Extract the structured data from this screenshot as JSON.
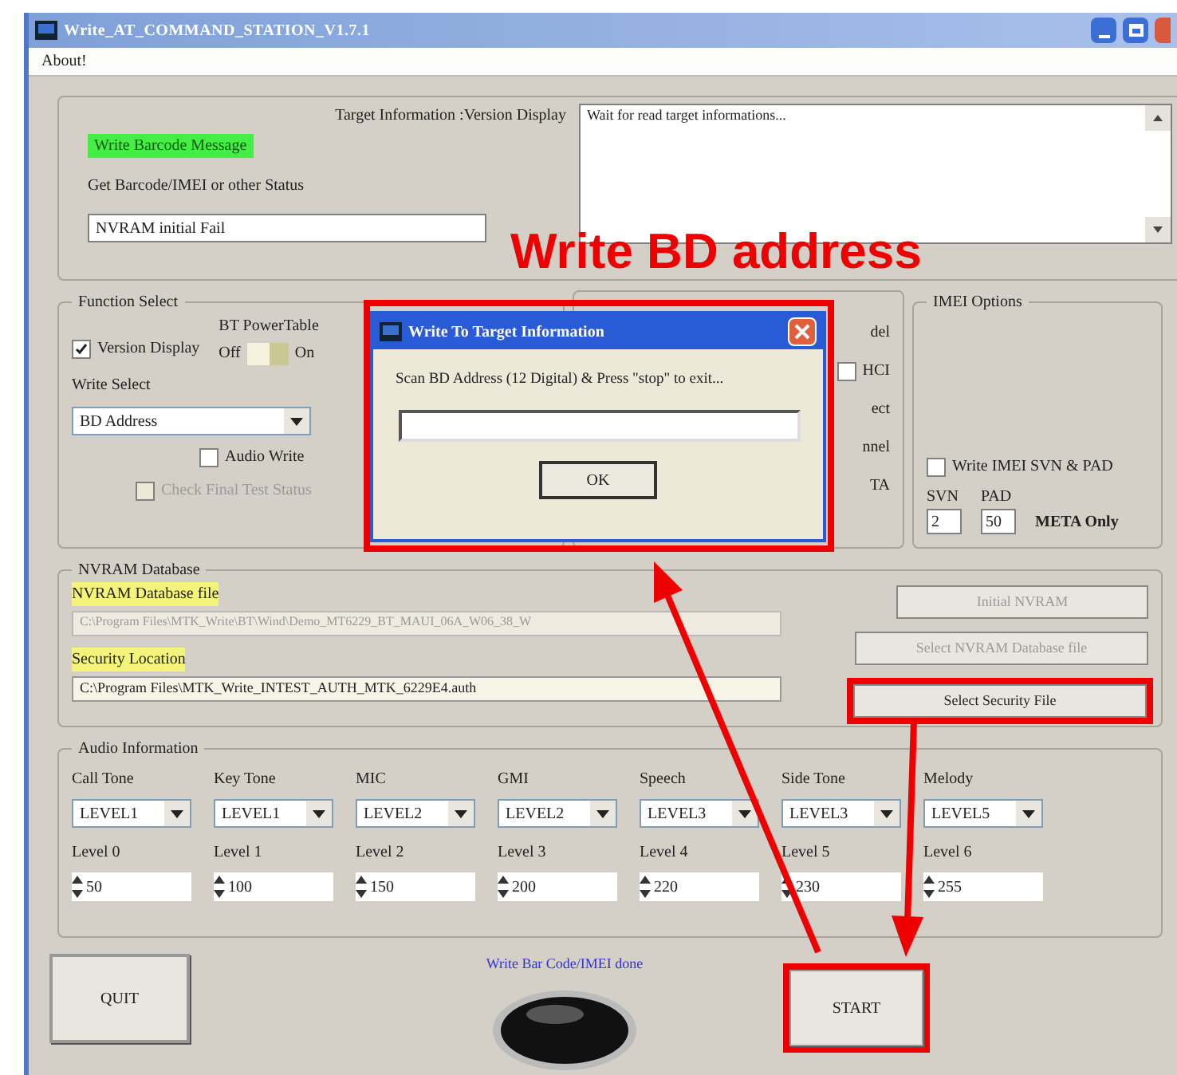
{
  "window": {
    "title": "Write_AT_COMMAND_STATION_V1.7.1"
  },
  "menu": [
    "About!"
  ],
  "target_info": {
    "title": "Target Information :Version Display",
    "barcode_message": "Write Barcode Message",
    "status_label": "Get Barcode/IMEI or other Status",
    "status_value": "NVRAM initial Fail",
    "log": "Wait for read target informations..."
  },
  "function_select": {
    "title": "Function Select",
    "version_display": {
      "label": "Version Display",
      "checked": true
    },
    "bt_power_table": {
      "label": "BT PowerTable",
      "off": "Off",
      "on_label": "On",
      "on": true
    },
    "write_select_label": "Write Select",
    "write_select_value": "BD Address",
    "audio_write": {
      "label": "Audio Write",
      "checked": false
    },
    "check_final": {
      "label": "Check Final Test Status",
      "checked": false,
      "disabled": true
    }
  },
  "middle_group": {
    "fragments": [
      {
        "kind": "text",
        "label": "del"
      },
      {
        "kind": "checkbox",
        "label": "HCI",
        "checked": false
      },
      {
        "kind": "text",
        "label": "ect"
      },
      {
        "kind": "text",
        "label": "nnel"
      },
      {
        "kind": "text",
        "label": "TA"
      }
    ]
  },
  "imei_options": {
    "title": "IMEI Options",
    "write_svn_pad": {
      "label": "Write IMEI SVN & PAD",
      "checked": false
    },
    "svn_label": "SVN",
    "svn_value": "2",
    "pad_label": "PAD",
    "pad_value": "50",
    "meta_only": "META Only"
  },
  "nvram": {
    "title": "NVRAM Database",
    "db_label": "NVRAM Database file",
    "db_path": "C:\\Program Files\\MTK_Write\\BT\\Wind\\Demo_MT6229_BT_MAUI_06A_W06_38_W",
    "security_label": "Security Location",
    "security_path": "C:\\Program Files\\MTK_Write_INTEST_AUTH_MTK_6229E4.auth",
    "buttons": [
      {
        "label": "Initial NVRAM",
        "disabled": true
      },
      {
        "label": "Select NVRAM Database file",
        "disabled": true
      },
      {
        "label": "Select Security File",
        "disabled": false
      }
    ]
  },
  "audio": {
    "title": "Audio Information",
    "items": [
      {
        "name": "Call Tone",
        "value": "LEVEL1",
        "level_label": "Level 0",
        "level_value": "50"
      },
      {
        "name": "Key Tone",
        "value": "LEVEL1",
        "level_label": "Level 1",
        "level_value": "100"
      },
      {
        "name": "MIC",
        "value": "LEVEL2",
        "level_label": "Level 2",
        "level_value": "150"
      },
      {
        "name": "GMI",
        "value": "LEVEL2",
        "level_label": "Level 3",
        "level_value": "200"
      },
      {
        "name": "Speech",
        "value": "LEVEL3",
        "level_label": "Level 4",
        "level_value": "220"
      },
      {
        "name": "Side Tone",
        "value": "LEVEL3",
        "level_label": "Level 5",
        "level_value": "230"
      },
      {
        "name": "Melody",
        "value": "LEVEL5",
        "level_label": "Level 6",
        "level_value": "255"
      }
    ]
  },
  "bottom": {
    "quit": "QUIT",
    "status": "Write Bar Code/IMEI done",
    "start": "START"
  },
  "dialog": {
    "title": "Write To Target Information",
    "message": "Scan BD Address (12 Digital) & Press \"stop\" to exit...",
    "ok": "OK"
  },
  "annotation": {
    "caption": "Write BD address"
  }
}
